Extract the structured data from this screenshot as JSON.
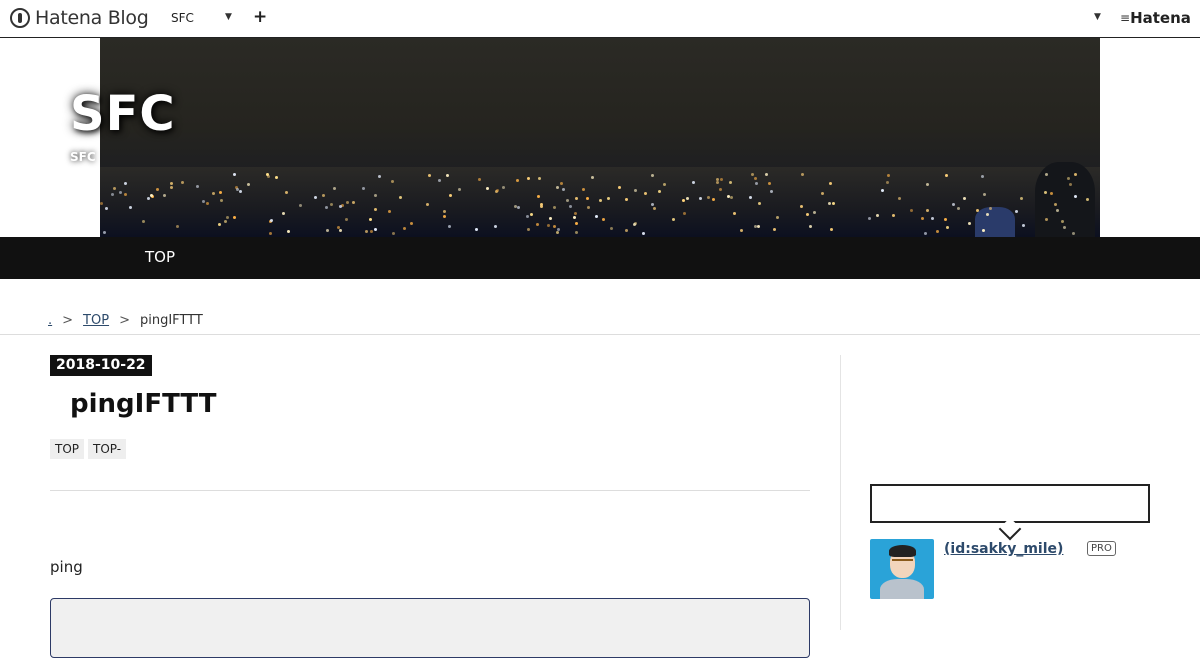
{
  "globalheader": {
    "brand": "Hatena Blog",
    "blog_select": "SFC",
    "plus_label": "+",
    "hatena_label": "Hatena"
  },
  "banner": {
    "title": "SFC",
    "description": "SFC"
  },
  "nav": {
    "items": [
      {
        "label": "TOP"
      }
    ]
  },
  "breadcrumb": {
    "home": ".",
    "sep": ">",
    "top": "TOP",
    "current": "pingIFTTT"
  },
  "entry": {
    "date": "2018-10-22",
    "title": "pingIFTTT",
    "categories": [
      {
        "label": "TOP"
      },
      {
        "label": "TOP-"
      }
    ],
    "body_text": "ping"
  },
  "sidebar": {
    "user_link": " (id:sakky_mile)",
    "pro_badge": "PRO"
  }
}
